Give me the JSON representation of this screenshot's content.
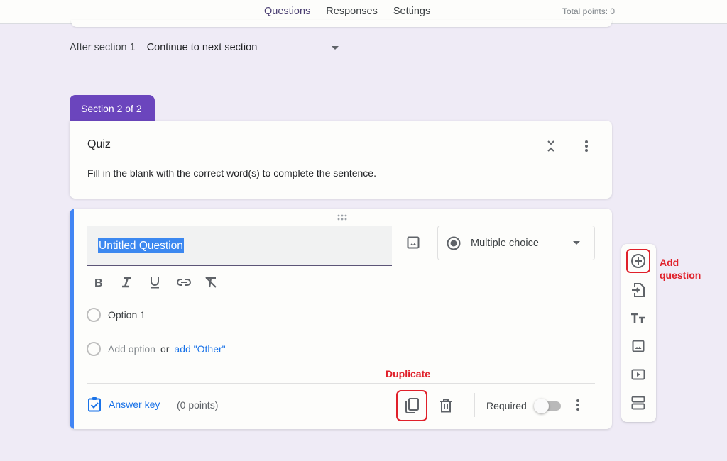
{
  "header": {
    "tabs": [
      {
        "label": "Questions",
        "active": true
      },
      {
        "label": "Responses",
        "active": false
      },
      {
        "label": "Settings",
        "active": false
      }
    ],
    "total_points": "Total points: 0"
  },
  "after_section": {
    "label": "After section 1",
    "selected": "Continue to next section"
  },
  "section": {
    "tab_label": "Section 2 of 2",
    "title": "Quiz",
    "description": "Fill in the blank with the correct word(s) to complete the sentence."
  },
  "question": {
    "title": "Untitled Question",
    "type": "Multiple choice",
    "format_tools": [
      "bold",
      "italic",
      "underline",
      "link",
      "clear-formatting"
    ],
    "options": [
      "Option 1"
    ],
    "add_option": "Add option",
    "or": "or",
    "add_other": "add \"Other\"",
    "answer_key": "Answer key",
    "points": "(0 points)",
    "required_label": "Required",
    "required": false
  },
  "side_toolbar": {
    "items": [
      "add-question",
      "import-questions",
      "add-title-description",
      "add-image",
      "add-video",
      "add-section"
    ]
  },
  "annotations": {
    "duplicate": "Duplicate",
    "add_question_line1": "Add",
    "add_question_line2": "question"
  },
  "colors": {
    "accent": "#6b45bd",
    "active_tab": "#4a3a8c",
    "question_accent": "#4285f4",
    "link": "#1a73e8",
    "annotation": "#e0202a",
    "background": "#efebf6"
  }
}
